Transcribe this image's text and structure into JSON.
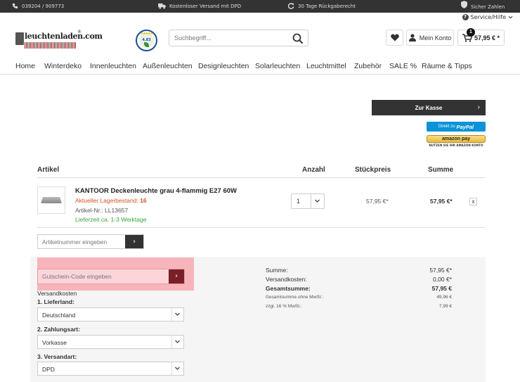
{
  "topbar": {
    "phone": "039204 / 909773",
    "shipping": "Kostenloser Versand mit DPD",
    "returns": "30 Tage Rückgaberecht",
    "secure": "Sicher Zahlen"
  },
  "service": {
    "label": "Service/Hilfe"
  },
  "logo": {
    "text": "leuchtenladen.com",
    "reg": "®"
  },
  "seal": {
    "stars": "★★★★★",
    "number": "4.83"
  },
  "search": {
    "placeholder": "Suchbegriff..."
  },
  "header": {
    "account_label": "Mein Konto",
    "cart_count": "1",
    "cart_total": "57,95 € *"
  },
  "nav": {
    "items": [
      "Home",
      "Winterdeko",
      "Innenleuchten",
      "Außenleuchten",
      "Designleuchten",
      "Solarleuchten",
      "Leuchtmittel",
      "Zubehör",
      "SALE %",
      "Räume & Tipps"
    ]
  },
  "checkout": {
    "kasse_label": "Zur Kasse",
    "paypal_prefix": "Direkt zu",
    "paypal_brand": "PayPal",
    "amazon_label": "amazon pay",
    "amazon_sub": "NUTZEN SIE IHR AMAZON KONTO"
  },
  "table": {
    "headers": {
      "article": "Artikel",
      "qty": "Anzahl",
      "unit": "Stückpreis",
      "sum": "Summe"
    }
  },
  "item": {
    "name": "KANTOOR Deckenleuchte grau 4-flammig E27 60W",
    "stock_label": "Aktueller Lagerbestand:",
    "stock_value": "16",
    "article_nr": "Artikel-Nr.: LL13657",
    "delivery": "Lieferzeit ca. 1-3 Werktage",
    "qty": "1",
    "unit_price": "57,95 €*",
    "sum": "57,95 €*",
    "remove": "x"
  },
  "article_input": {
    "placeholder": "Artikelnummer eingeben"
  },
  "coupon": {
    "placeholder": "Gutschein-Code eingeben"
  },
  "shipping": {
    "title": "Versandkosten",
    "country_label": "1. Lieferland:",
    "country_value": "Deutschland",
    "payment_label": "2. Zahlungsart:",
    "payment_value": "Vorkasse",
    "method_label": "3. Versandart:",
    "method_value": "DPD"
  },
  "totals": {
    "sum_label": "Summe:",
    "sum_value": "57,95 €*",
    "ship_label": "Versandkosten:",
    "ship_value": "0,00 €*",
    "grand_label": "Gesamtsumme:",
    "grand_value": "57,95 €",
    "net_label": "Gesamtsumme ohne MwSt.:",
    "net_value": "49,96 €",
    "vat_label": "zzgl. 16 % MwSt.:",
    "vat_value": "7,99 €"
  },
  "colors": {
    "topbar": "#333333",
    "highlight": "#f7b4bb",
    "coupon_button": "#7a1f26",
    "stock_orange": "#d9531e",
    "delivery_green": "#3aa53a",
    "paypal_blue": "#0a93d8"
  }
}
